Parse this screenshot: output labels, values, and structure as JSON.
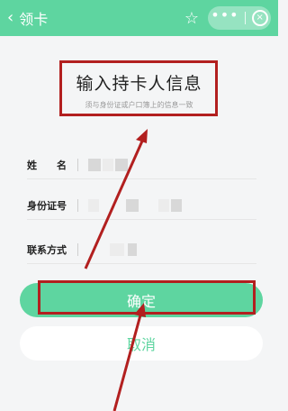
{
  "header": {
    "title": "领卡",
    "back_icon": "chevron-left-icon"
  },
  "form": {
    "title": "输入持卡人信息",
    "subtitle": "须与身份证或户口簿上的信息一致",
    "fields": [
      {
        "label": "姓　　名"
      },
      {
        "label": "身份证号"
      },
      {
        "label": "联系方式"
      }
    ]
  },
  "actions": {
    "confirm_label": "确定",
    "cancel_label": "取消"
  },
  "colors": {
    "accent": "#5ed5a0",
    "annotation": "#b21f1f"
  }
}
